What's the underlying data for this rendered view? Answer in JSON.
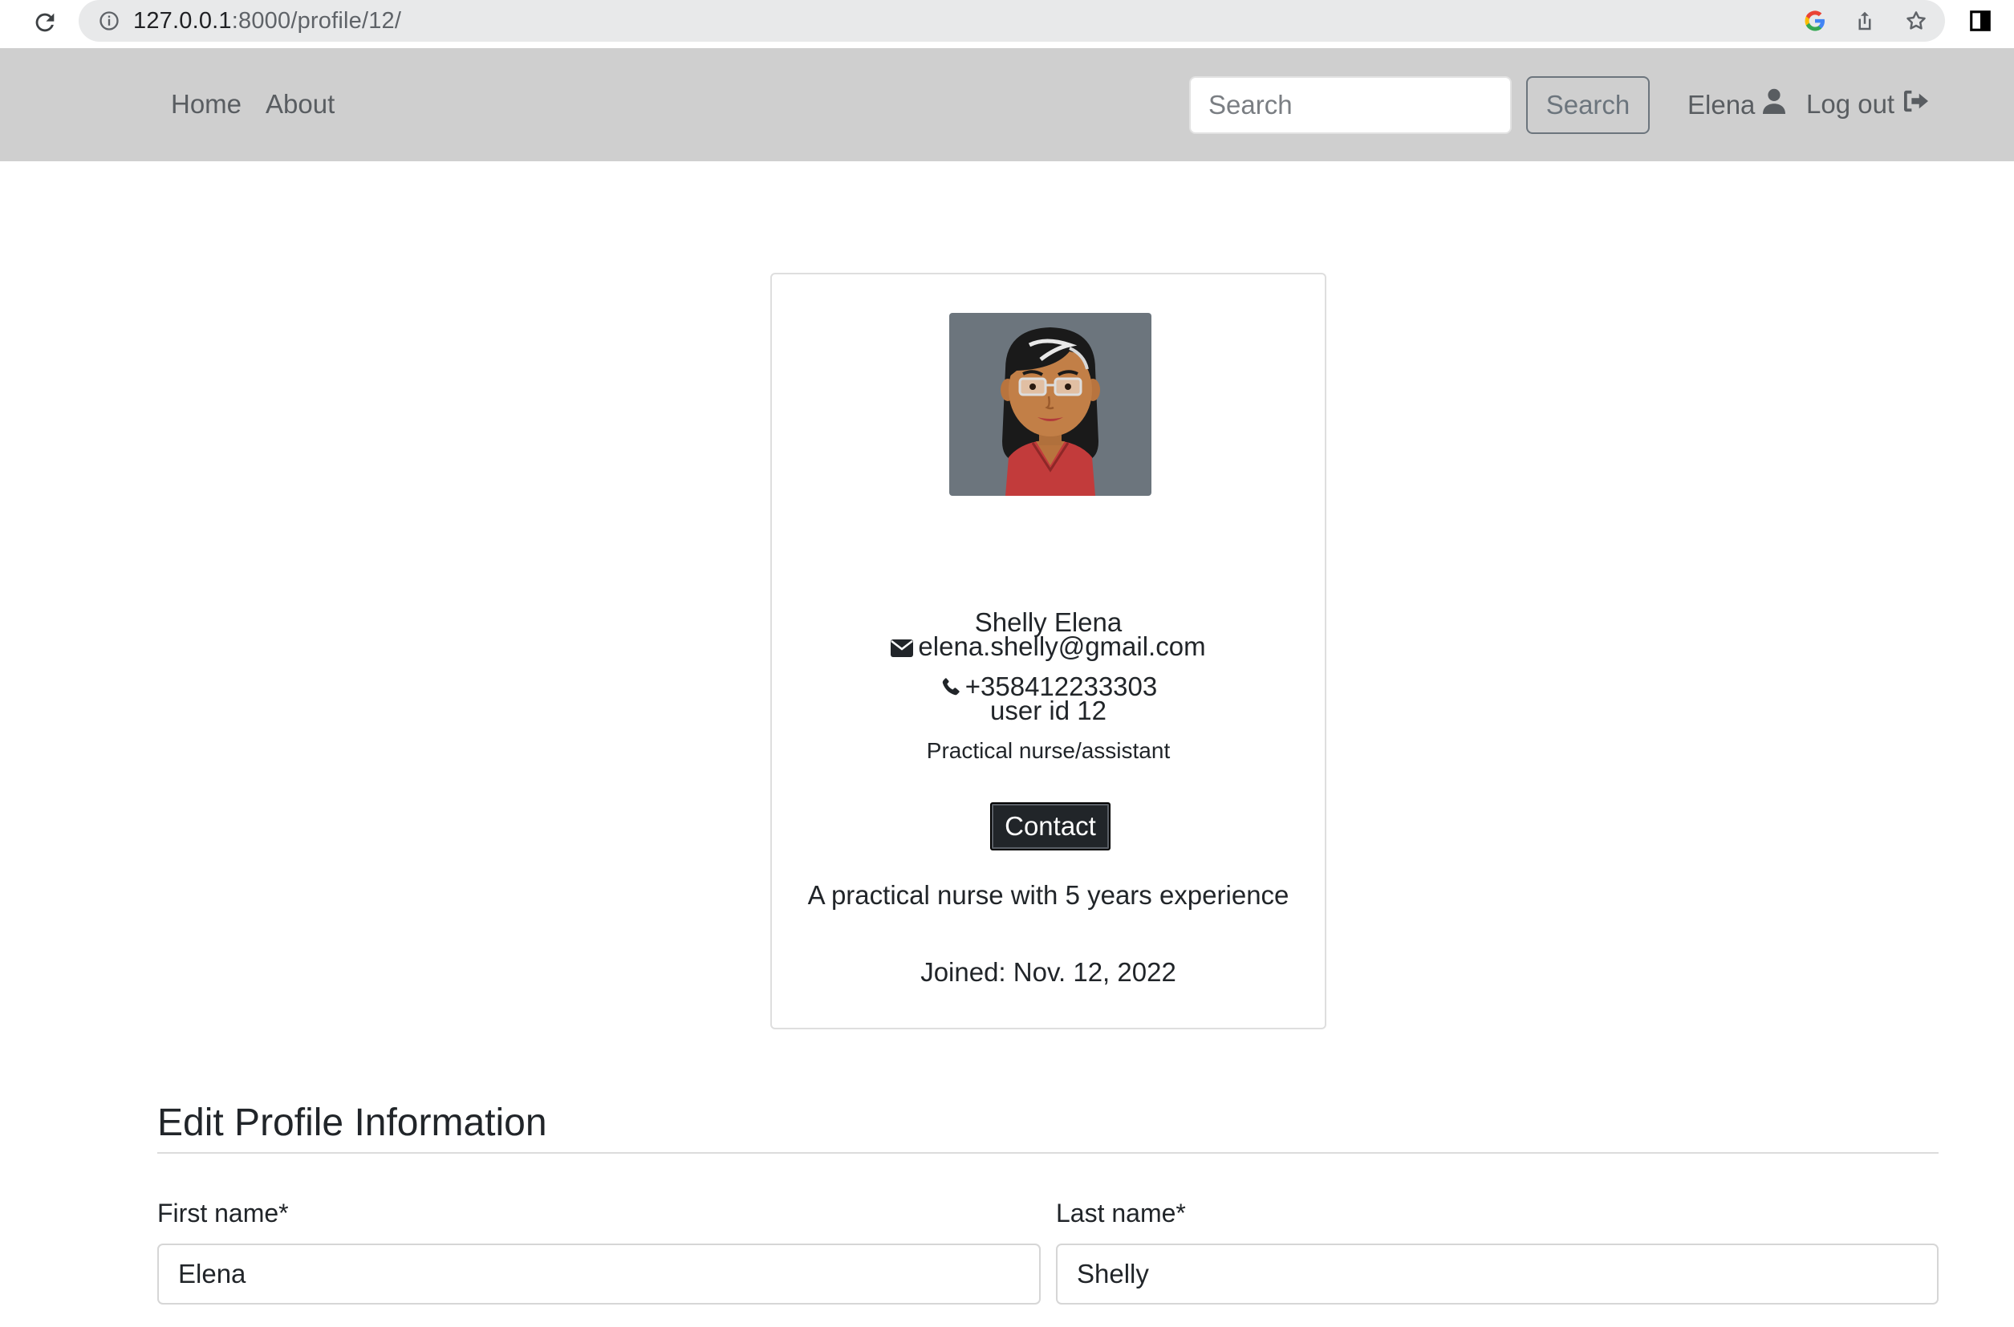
{
  "browser": {
    "url_host": "127.0.0.1",
    "url_rest": ":8000/profile/12/",
    "icons": [
      "reload-icon",
      "site-info-icon",
      "google-icon",
      "share-icon",
      "bookmark-star-icon",
      "side-panel-icon"
    ]
  },
  "navbar": {
    "links": [
      "Home",
      "About"
    ],
    "search_placeholder": "Search",
    "search_button": "Search",
    "user_name": "Elena",
    "logout": "Log out"
  },
  "profile": {
    "full_name": "Shelly Elena",
    "email": "elena.shelly@gmail.com",
    "phone": "+358412233303",
    "user_id": "user id 12",
    "occupation": "Practical nurse/assistant",
    "contact_button": "Contact",
    "bio": "A practical nurse with 5 years experience",
    "joined": "Joined: Nov. 12, 2022"
  },
  "form": {
    "title": "Edit Profile Information",
    "first_name_label": "First name*",
    "first_name_value": "Elena",
    "last_name_label": "Last name*",
    "last_name_value": "Shelly"
  },
  "colors": {
    "navbar_bg": "#cfcfcf",
    "avatar_bg": "#6c757d",
    "contact_btn_bg": "#212529"
  }
}
